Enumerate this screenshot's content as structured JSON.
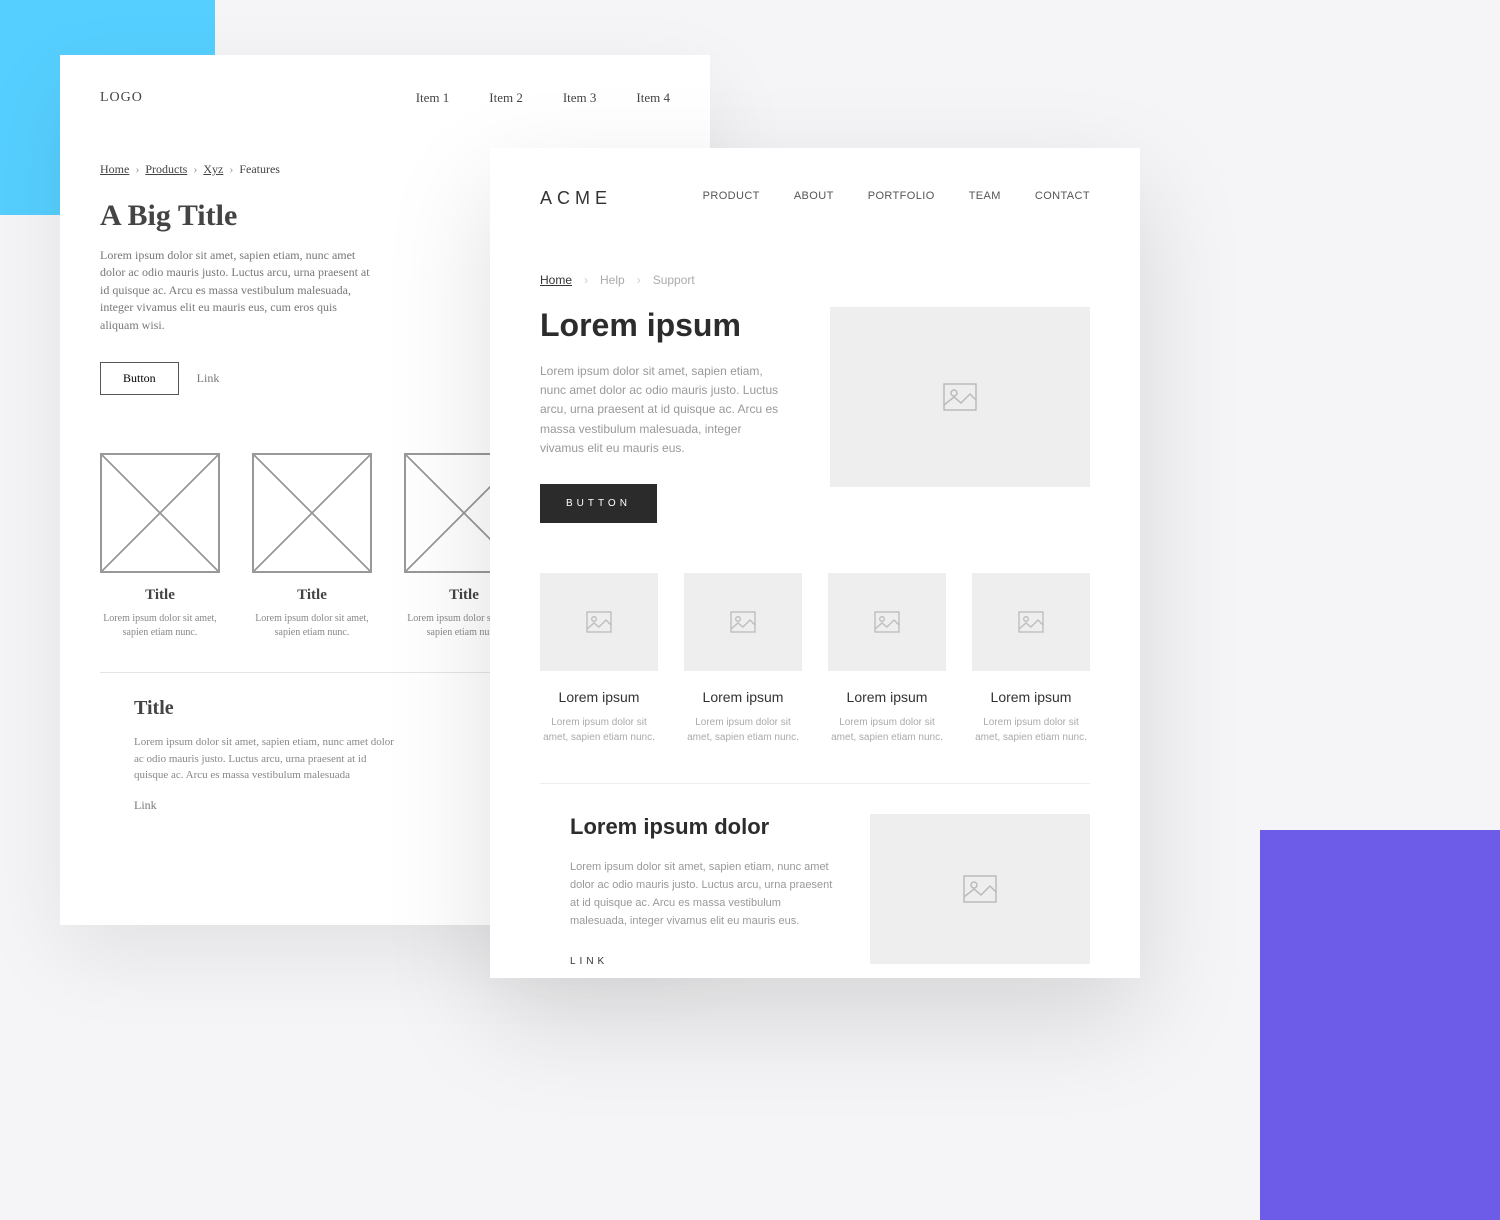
{
  "wire": {
    "logo": "LOGO",
    "nav": [
      "Item 1",
      "Item 2",
      "Item 3",
      "Item 4"
    ],
    "breadcrumb": [
      "Home",
      "Products",
      "Xyz",
      "Features"
    ],
    "hero": {
      "title": "A Big Title",
      "body": "Lorem ipsum dolor sit amet, sapien etiam, nunc amet dolor ac odio mauris justo. Luctus arcu, urna praesent at id quisque ac. Arcu es massa vestibulum malesuada, integer vivamus elit eu mauris eus, cum eros quis aliquam wisi.",
      "button": "Button",
      "link": "Link"
    },
    "cards": [
      {
        "title": "Title",
        "body": "Lorem ipsum dolor sit amet, sapien etiam nunc."
      },
      {
        "title": "Title",
        "body": "Lorem ipsum dolor sit amet, sapien etiam nunc."
      },
      {
        "title": "Title",
        "body": "Lorem ipsum dolor sit amet, sapien etiam nunc."
      }
    ],
    "section": {
      "title": "Title",
      "body": "Lorem ipsum dolor sit amet, sapien etiam, nunc amet dolor ac odio mauris justo. Luctus arcu, urna praesent at id quisque ac. Arcu es massa vestibulum malesuada",
      "link": "Link"
    }
  },
  "real": {
    "brand": "ACME",
    "nav": [
      "PRODUCT",
      "ABOUT",
      "PORTFOLIO",
      "TEAM",
      "CONTACT"
    ],
    "breadcrumb": [
      "Home",
      "Help",
      "Support"
    ],
    "hero": {
      "title": "Lorem ipsum",
      "body": "Lorem ipsum dolor sit amet, sapien etiam, nunc amet dolor ac odio mauris justo. Luctus arcu, urna praesent at id quisque ac. Arcu es massa vestibulum malesuada, integer vivamus elit eu mauris eus.",
      "button": "BUTTON"
    },
    "cards": [
      {
        "title": "Lorem ipsum",
        "body": "Lorem ipsum dolor sit amet, sapien etiam nunc."
      },
      {
        "title": "Lorem ipsum",
        "body": "Lorem ipsum dolor sit amet, sapien etiam nunc."
      },
      {
        "title": "Lorem ipsum",
        "body": "Lorem ipsum dolor sit amet, sapien etiam nunc."
      },
      {
        "title": "Lorem ipsum",
        "body": "Lorem ipsum dolor sit amet, sapien etiam nunc."
      }
    ],
    "section": {
      "title": "Lorem ipsum dolor",
      "body": "Lorem ipsum dolor sit amet, sapien etiam, nunc amet dolor ac odio mauris justo. Luctus arcu, urna praesent at id quisque ac. Arcu es massa vestibulum malesuada, integer vivamus elit eu mauris eus.",
      "link": "LINK"
    }
  }
}
